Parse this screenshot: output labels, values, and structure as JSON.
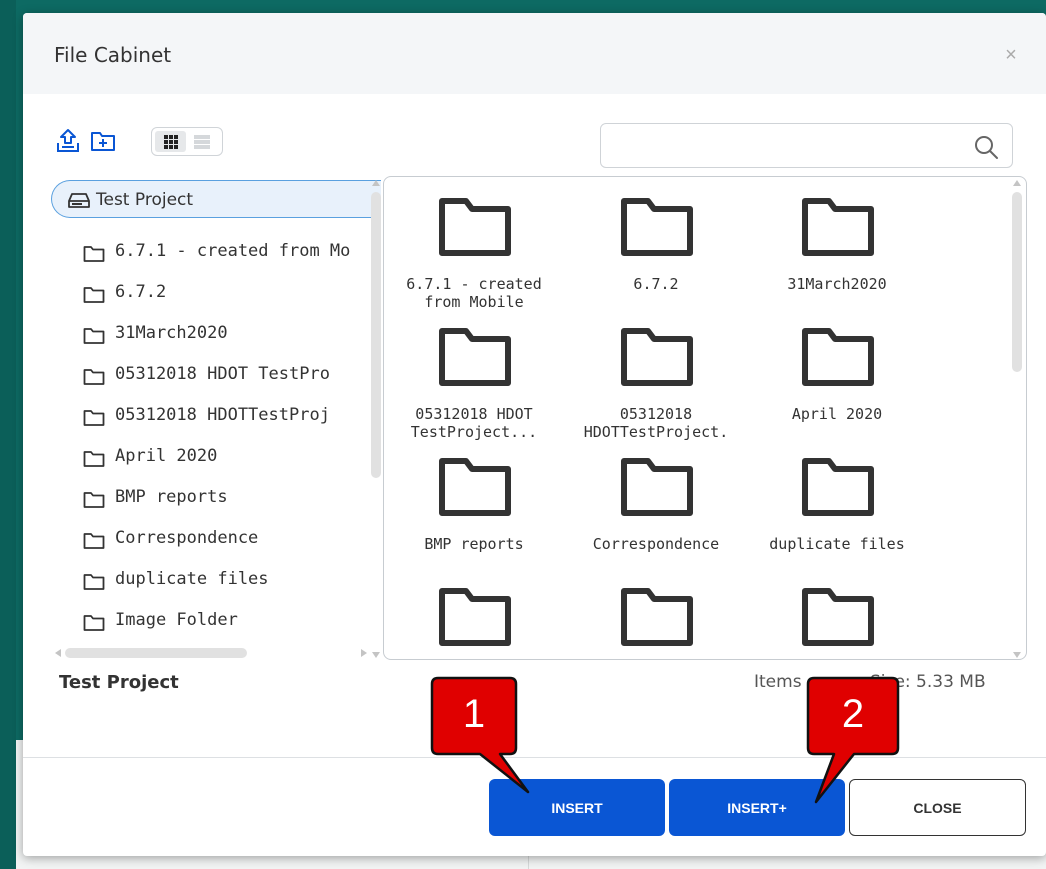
{
  "dialog": {
    "title": "File Cabinet",
    "close_glyph": "×"
  },
  "toolbar": {
    "upload_icon": "upload-icon",
    "new_folder_icon": "new-folder-icon",
    "view_modes": [
      "grid-view",
      "list-view"
    ],
    "active_view": "grid-view"
  },
  "search": {
    "value": "",
    "placeholder": "",
    "icon": "search-icon"
  },
  "tree": {
    "root_label": "Test Project",
    "items": [
      {
        "label": "6.7.1 - created from Mo"
      },
      {
        "label": "6.7.2"
      },
      {
        "label": "31March2020"
      },
      {
        "label": "05312018 HDOT TestPro"
      },
      {
        "label": "05312018 HDOTTestProj"
      },
      {
        "label": "April 2020"
      },
      {
        "label": "BMP reports"
      },
      {
        "label": "Correspondence"
      },
      {
        "label": "duplicate files"
      },
      {
        "label": "Image Folder"
      }
    ]
  },
  "grid": {
    "items": [
      {
        "line1": "6.7.1 - created",
        "line2": "from Mobile"
      },
      {
        "line1": "6.7.2",
        "line2": ""
      },
      {
        "line1": "31March2020",
        "line2": ""
      },
      {
        "line1": "05312018 HDOT",
        "line2": "TestProject..."
      },
      {
        "line1": "05312018",
        "line2": "HDOTTestProject."
      },
      {
        "line1": "April 2020",
        "line2": ""
      },
      {
        "line1": "BMP reports",
        "line2": ""
      },
      {
        "line1": "Correspondence",
        "line2": ""
      },
      {
        "line1": "duplicate files",
        "line2": ""
      },
      {
        "line1": "",
        "line2": ""
      },
      {
        "line1": "",
        "line2": ""
      },
      {
        "line1": "",
        "line2": ""
      }
    ]
  },
  "footer": {
    "current_folder": "Test Project",
    "items_label": "Items",
    "size_label": "Size: 5.33 MB"
  },
  "buttons": {
    "insert": "INSERT",
    "insert_plus": "INSERT+",
    "close": "CLOSE"
  },
  "callouts": [
    {
      "label": "1"
    },
    {
      "label": "2"
    }
  ],
  "colors": {
    "primary": "#0a56d4",
    "callout": "#e00000",
    "background": "#0d6a63",
    "selection_border": "#5aa0df"
  }
}
